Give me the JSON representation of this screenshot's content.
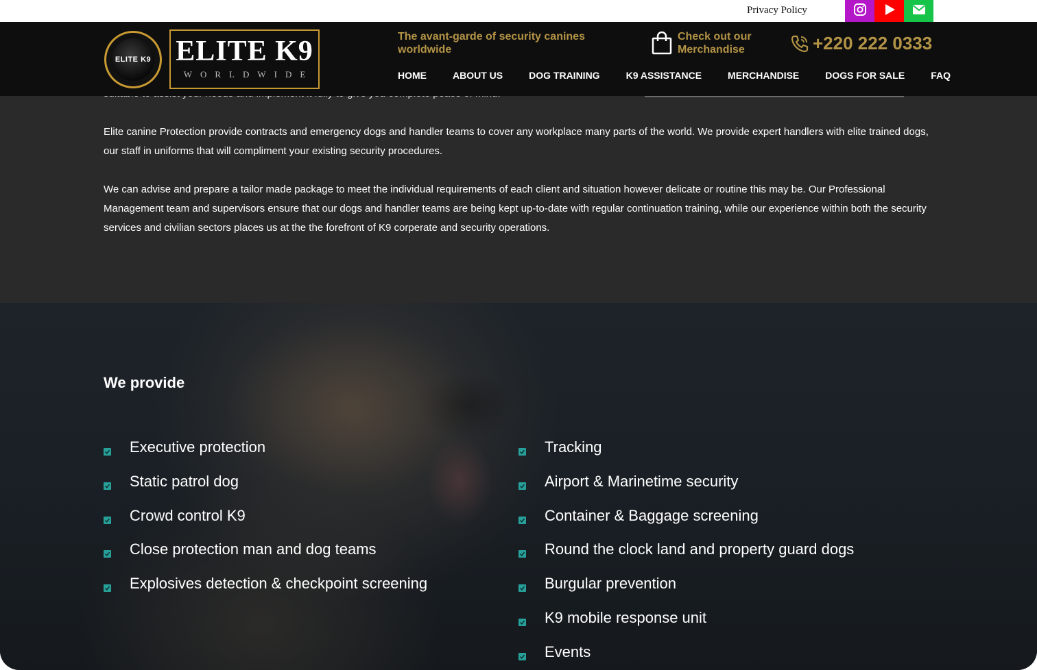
{
  "topbar": {
    "privacy_label": "Privacy Policy",
    "social": [
      {
        "name": "instagram-icon",
        "color": "#b317c8"
      },
      {
        "name": "youtube-icon",
        "color": "#ff0000"
      },
      {
        "name": "mail-icon",
        "color": "#16c44a"
      }
    ]
  },
  "header": {
    "logo_badge_text": "ELITE K9",
    "logo_title": "ELITE K9",
    "logo_subtitle": "WORLDWIDE",
    "tagline": "The avant-garde of security canines worldwide",
    "merch_label": "Check out our Merchandise",
    "phone": "+220 222 0333",
    "accent_color": "#b39446",
    "nav": [
      "HOME",
      "ABOUT US",
      "DOG TRAINING",
      "K9 ASSISTANCE",
      "MERCHANDISE",
      "DOGS FOR SALE",
      "FAQ"
    ]
  },
  "intro": {
    "cut_line": "suitable to assist your needs and implement it fully to give you complete peace of mind.",
    "paragraph_1": "Elite canine Protection provide contracts and emergency dogs and handler teams to cover any workplace many parts of the world. We provide expert handlers with elite trained dogs, our staff in uniforms that will compliment your existing security procedures.",
    "paragraph_2": "We can advise and prepare a tailor made package to meet the individual requirements of each client and situation however delicate or routine this may be. Our Professional Management team and supervisors ensure that our dogs and handler teams are being kept up-to-date with regular continuation training, while our experience within both the security services and civilian sectors places us at the the forefront of K9 corperate and security operations."
  },
  "provide": {
    "title": "We provide",
    "left": [
      "Executive protection",
      "Static patrol dog",
      "Crowd control K9",
      "Close protection man and dog teams",
      "Explosives detection & checkpoint screening"
    ],
    "right": [
      "Tracking",
      "Airport & Marinetime security",
      "Container & Baggage screening",
      "Round the clock land and property guard dogs",
      "Burgular prevention",
      "K9 mobile response unit",
      "Events"
    ],
    "check_color": "#27a09a"
  }
}
